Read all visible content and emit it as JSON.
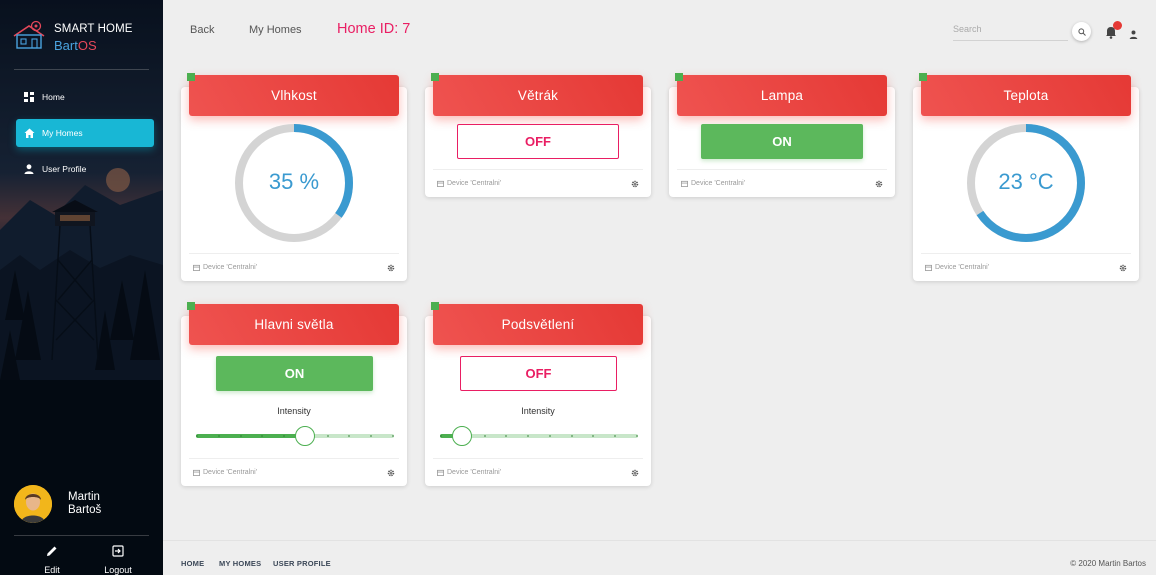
{
  "app": {
    "title": "SMART HOME",
    "subtitle_part1": "Bart",
    "subtitle_part2": "OS"
  },
  "sidebar": {
    "items": [
      {
        "label": "Home",
        "icon": "dashboard-icon",
        "active": false
      },
      {
        "label": "My Homes",
        "icon": "home-icon",
        "active": true
      },
      {
        "label": "User Profile",
        "icon": "person-icon",
        "active": false
      }
    ],
    "user": {
      "first": "Martin",
      "last": "Bartoš"
    },
    "bottom": {
      "edit_label": "Edit",
      "logout_label": "Logout"
    }
  },
  "topbar": {
    "back_label": "Back",
    "myhomes_label": "My Homes",
    "home_id": "Home ID: 7",
    "search_placeholder": "Search"
  },
  "devices": {
    "vlhkost": {
      "title": "Vlhkost",
      "value_text": "35 %",
      "value": 35,
      "max": 100,
      "footer": "Device 'Centralni'"
    },
    "vetrak": {
      "title": "Větrák",
      "state": "OFF",
      "footer": "Device 'Centralni'"
    },
    "lampa": {
      "title": "Lampa",
      "state": "ON",
      "footer": "Device 'Centralni'"
    },
    "teplota": {
      "title": "Teplota",
      "value_text": "23 °C",
      "value": 23,
      "max": 35,
      "footer": "Device 'Centralni'"
    },
    "hlavni": {
      "title": "Hlavni světla",
      "state": "ON",
      "intensity_label": "Intensity",
      "intensity": 0.55,
      "footer": "Device 'Centralni'"
    },
    "podsvetleni": {
      "title": "Podsvětlení",
      "state": "OFF",
      "intensity_label": "Intensity",
      "intensity": 0.11,
      "footer": "Device 'Centralni'"
    }
  },
  "footer": {
    "links": [
      "HOME",
      "MY HOMES",
      "USER PROFILE"
    ],
    "copyright": "© 2020 Martin Bartos"
  },
  "colors": {
    "accent": "#18b7d5",
    "header_red": "#e53935",
    "on_green": "#5cb85c",
    "off_pink": "#e91e63",
    "gauge_blue": "#3a9ad0"
  }
}
